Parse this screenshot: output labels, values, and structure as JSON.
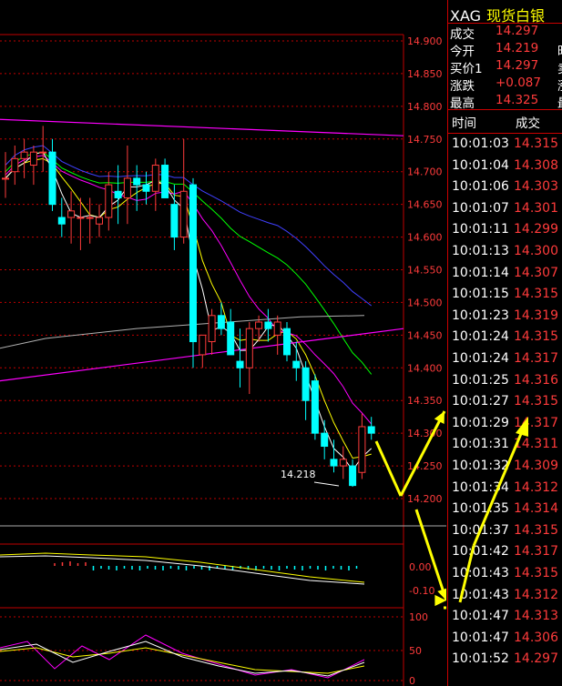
{
  "chart": {
    "y_ticks": [
      "14.900",
      "14.850",
      "14.800",
      "14.750",
      "14.700",
      "14.650",
      "14.600",
      "14.550",
      "14.500",
      "14.450",
      "14.400",
      "14.350",
      "14.300",
      "14.250",
      "14.200"
    ],
    "low_label": "14.218",
    "macd_ticks": [
      "0.00",
      "-0.10"
    ],
    "kdj_ticks": [
      "100",
      "50",
      "0"
    ],
    "colors": {
      "up": "#ff3b3b",
      "down": "#00ffff",
      "grid": "#c00000",
      "ma5": "#ffffff",
      "ma10": "#ffff00",
      "ma20": "#ff00ff",
      "ma30": "#00ff00",
      "ma60": "#4040ff",
      "ma120": "#b0b0b0",
      "arrow": "#ffff00"
    }
  },
  "quote": {
    "symbol": "XAG",
    "name": "现货白银",
    "rows": [
      {
        "label": "成交",
        "value": "14.297",
        "extra": ""
      },
      {
        "label": "今开",
        "value": "14.219",
        "extra": "昨"
      },
      {
        "label": "买价1",
        "value": "14.297",
        "extra": "卖"
      },
      {
        "label": "涨跌",
        "value": "+0.087",
        "extra": "涨"
      },
      {
        "label": "最高",
        "value": "14.325",
        "extra": "最"
      }
    ]
  },
  "ticks": {
    "header_time": "时间",
    "header_price": "成交",
    "rows": [
      {
        "time": "10:01:03",
        "price": "14.315"
      },
      {
        "time": "10:01:04",
        "price": "14.308"
      },
      {
        "time": "10:01:06",
        "price": "14.303"
      },
      {
        "time": "10:01:07",
        "price": "14.301"
      },
      {
        "time": "10:01:11",
        "price": "14.299"
      },
      {
        "time": "10:01:13",
        "price": "14.300"
      },
      {
        "time": "10:01:14",
        "price": "14.307"
      },
      {
        "time": "10:01:15",
        "price": "14.315"
      },
      {
        "time": "10:01:23",
        "price": "14.319"
      },
      {
        "time": "10:01:24",
        "price": "14.315"
      },
      {
        "time": "10:01:24",
        "price": "14.317"
      },
      {
        "time": "10:01:25",
        "price": "14.316"
      },
      {
        "time": "10:01:27",
        "price": "14.315"
      },
      {
        "time": "10:01:29",
        "price": "14.317"
      },
      {
        "time": "10:01:31",
        "price": "14.311"
      },
      {
        "time": "10:01:32",
        "price": "14.309"
      },
      {
        "time": "10:01:34",
        "price": "14.312"
      },
      {
        "time": "10:01:35",
        "price": "14.314"
      },
      {
        "time": "10:01:37",
        "price": "14.315"
      },
      {
        "time": "10:01:42",
        "price": "14.317"
      },
      {
        "time": "10:01:43",
        "price": "14.315"
      },
      {
        "time": "10:01:43",
        "price": "14.312"
      },
      {
        "time": "10:01:47",
        "price": "14.313"
      },
      {
        "time": "10:01:47",
        "price": "14.306"
      },
      {
        "time": "10:01:52",
        "price": "14.297"
      }
    ]
  },
  "chart_data": {
    "type": "candlestick",
    "ylim": [
      14.2,
      14.9
    ],
    "candles": [
      {
        "o": 14.69,
        "h": 14.73,
        "l": 14.66,
        "c": 14.69
      },
      {
        "o": 14.7,
        "h": 14.74,
        "l": 14.68,
        "c": 14.72
      },
      {
        "o": 14.72,
        "h": 14.75,
        "l": 14.69,
        "c": 14.73
      },
      {
        "o": 14.71,
        "h": 14.74,
        "l": 14.68,
        "c": 14.73
      },
      {
        "o": 14.73,
        "h": 14.77,
        "l": 14.7,
        "c": 14.73
      },
      {
        "o": 14.73,
        "h": 14.75,
        "l": 14.64,
        "c": 14.65
      },
      {
        "o": 14.63,
        "h": 14.66,
        "l": 14.6,
        "c": 14.62
      },
      {
        "o": 14.63,
        "h": 14.67,
        "l": 14.59,
        "c": 14.64
      },
      {
        "o": 14.63,
        "h": 14.66,
        "l": 14.58,
        "c": 14.63
      },
      {
        "o": 14.63,
        "h": 14.66,
        "l": 14.59,
        "c": 14.63
      },
      {
        "o": 14.62,
        "h": 14.65,
        "l": 14.6,
        "c": 14.63
      },
      {
        "o": 14.63,
        "h": 14.7,
        "l": 14.61,
        "c": 14.68
      },
      {
        "o": 14.67,
        "h": 14.71,
        "l": 14.62,
        "c": 14.66
      },
      {
        "o": 14.66,
        "h": 14.74,
        "l": 14.62,
        "c": 14.69
      },
      {
        "o": 14.69,
        "h": 14.71,
        "l": 14.64,
        "c": 14.68
      },
      {
        "o": 14.68,
        "h": 14.7,
        "l": 14.65,
        "c": 14.67
      },
      {
        "o": 14.67,
        "h": 14.72,
        "l": 14.64,
        "c": 14.71
      },
      {
        "o": 14.71,
        "h": 14.72,
        "l": 14.66,
        "c": 14.66
      },
      {
        "o": 14.65,
        "h": 14.68,
        "l": 14.58,
        "c": 14.6
      },
      {
        "o": 14.6,
        "h": 14.75,
        "l": 14.59,
        "c": 14.67
      },
      {
        "o": 14.68,
        "h": 14.69,
        "l": 14.4,
        "c": 14.44
      },
      {
        "o": 14.42,
        "h": 14.45,
        "l": 14.4,
        "c": 14.45
      },
      {
        "o": 14.44,
        "h": 14.49,
        "l": 14.42,
        "c": 14.48
      },
      {
        "o": 14.48,
        "h": 14.5,
        "l": 14.45,
        "c": 14.46
      },
      {
        "o": 14.47,
        "h": 14.49,
        "l": 14.42,
        "c": 14.42
      },
      {
        "o": 14.41,
        "h": 14.46,
        "l": 14.37,
        "c": 14.4
      },
      {
        "o": 14.4,
        "h": 14.47,
        "l": 14.36,
        "c": 14.46
      },
      {
        "o": 14.46,
        "h": 14.48,
        "l": 14.44,
        "c": 14.47
      },
      {
        "o": 14.47,
        "h": 14.49,
        "l": 14.44,
        "c": 14.46
      },
      {
        "o": 14.45,
        "h": 14.48,
        "l": 14.42,
        "c": 14.47
      },
      {
        "o": 14.46,
        "h": 14.47,
        "l": 14.41,
        "c": 14.42
      },
      {
        "o": 14.41,
        "h": 14.44,
        "l": 14.38,
        "c": 14.4
      },
      {
        "o": 14.4,
        "h": 14.41,
        "l": 14.32,
        "c": 14.35
      },
      {
        "o": 14.38,
        "h": 14.39,
        "l": 14.29,
        "c": 14.3
      },
      {
        "o": 14.3,
        "h": 14.32,
        "l": 14.26,
        "c": 14.28
      },
      {
        "o": 14.26,
        "h": 14.29,
        "l": 14.24,
        "c": 14.25
      },
      {
        "o": 14.25,
        "h": 14.28,
        "l": 14.23,
        "c": 14.26
      },
      {
        "o": 14.25,
        "h": 14.26,
        "l": 14.218,
        "c": 14.22
      },
      {
        "o": 14.24,
        "h": 14.33,
        "l": 14.23,
        "c": 14.31
      },
      {
        "o": 14.31,
        "h": 14.325,
        "l": 14.29,
        "c": 14.3
      }
    ]
  }
}
